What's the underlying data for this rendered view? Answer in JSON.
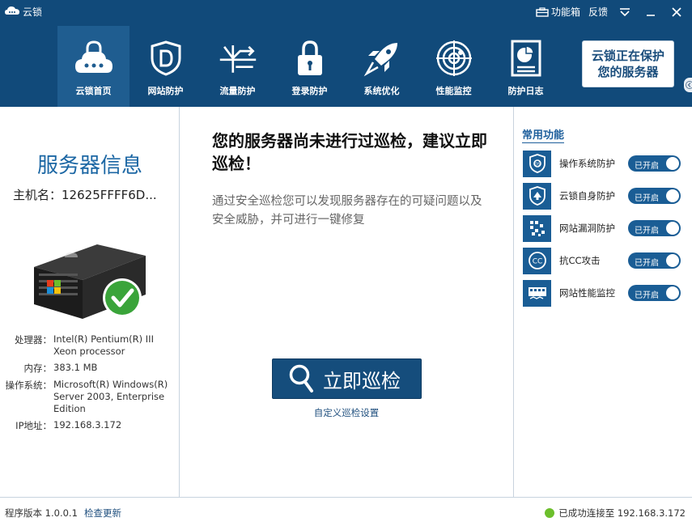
{
  "window": {
    "title": "云锁"
  },
  "titlebar": {
    "feature_box": "功能箱",
    "feedback": "反馈"
  },
  "nav": {
    "items": [
      {
        "label": "云锁首页",
        "icon": "cloud-lock-icon",
        "active": true
      },
      {
        "label": "网站防护",
        "icon": "shield-d-icon",
        "active": false
      },
      {
        "label": "流量防护",
        "icon": "traffic-icon",
        "active": false
      },
      {
        "label": "登录防护",
        "icon": "padlock-icon",
        "active": false
      },
      {
        "label": "系统优化",
        "icon": "rocket-icon",
        "active": false
      },
      {
        "label": "性能监控",
        "icon": "radar-icon",
        "active": false
      },
      {
        "label": "防护日志",
        "icon": "log-document-icon",
        "active": false
      }
    ]
  },
  "status_panel": {
    "line1": "云锁正在保护",
    "line2": "您的服务器"
  },
  "left": {
    "title": "服务器信息",
    "hostname_label": "主机名：",
    "hostname_value": "12625FFFF6D...",
    "specs": [
      {
        "label": "处理器：",
        "value": "Intel(R) Pentium(R) III Xeon processor"
      },
      {
        "label": "内存：",
        "value": "383.1 MB"
      },
      {
        "label": "操作系统：",
        "value": "Microsoft(R) Windows(R) Server 2003, Enterprise Edition"
      },
      {
        "label": "IP地址：",
        "value": "192.168.3.172"
      }
    ]
  },
  "center": {
    "headline": "您的服务器尚未进行过巡检，建议立即巡检！",
    "description": "通过安全巡检您可以发现服务器存在的可疑问题以及安全威胁，并可进行一键修复",
    "scan_button": "立即巡检",
    "custom_link": "自定义巡检设置"
  },
  "right": {
    "title": "常用功能",
    "functions": [
      {
        "label": "操作系统防护",
        "icon": "os-protect-icon",
        "toggle": "已开启",
        "on": true
      },
      {
        "label": "云锁自身防护",
        "icon": "self-protect-icon",
        "toggle": "已开启",
        "on": true
      },
      {
        "label": "网站漏洞防护",
        "icon": "vuln-protect-icon",
        "toggle": "已开启",
        "on": true
      },
      {
        "label": "抗CC攻击",
        "icon": "anti-cc-icon",
        "toggle": "已开启",
        "on": true
      },
      {
        "label": "网站性能监控",
        "icon": "perf-monitor-icon",
        "toggle": "已开启",
        "on": true
      }
    ]
  },
  "statusbar": {
    "version": "程序版本 1.0.0.1",
    "update_link": "检查更新",
    "connection": "已成功连接至 192.168.3.172",
    "connection_color": "#6cbf2c"
  },
  "colors": {
    "header_bg": "#114a7a",
    "active_nav_bg": "#1f5d90",
    "accent": "#1a5d95",
    "title_blue": "#1c67a4"
  }
}
